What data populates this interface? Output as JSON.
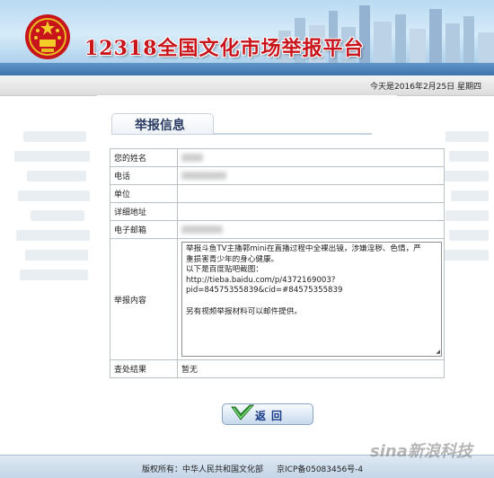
{
  "header": {
    "site_title": "12318全国文化市场举报平台",
    "date_text": "今天是2016年2月25日 星期四"
  },
  "section": {
    "title": "举报信息"
  },
  "form": {
    "name_label": "您的姓名",
    "phone_label": "电话",
    "unit_label": "单位",
    "address_label": "详细地址",
    "email_label": "电子邮箱",
    "content_label": "举报内容",
    "result_label": "查处结果",
    "result_value": "暂无",
    "content_lines": [
      "举报斗鱼TV主播郭mini在直播过程中全裸出镜，涉嫌淫秽、色情，严",
      "重损害青少年的身心健康。",
      "以下是百度贴吧截图：",
      "http://tieba.baidu.com/p/4372169003?",
      "pid=84575355839&cid=#84575355839",
      "",
      "另有视频举报材料可以邮件提供。"
    ]
  },
  "buttons": {
    "back_label": "返回"
  },
  "footer": {
    "copyright": "版权所有：中华人民共和国文化部",
    "icp": "京ICP备05083456号-4"
  },
  "watermark": {
    "text": "sina新浪科技"
  },
  "colors": {
    "title_red": "#c8141b",
    "section_title": "#2a3a62",
    "border": "#b9c0c6"
  }
}
